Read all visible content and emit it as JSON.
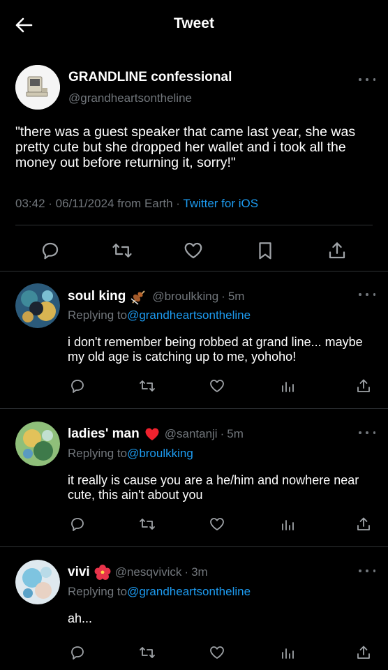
{
  "header": {
    "title": "Tweet"
  },
  "main_tweet": {
    "name": "GRANDLINE confessional",
    "handle": "@grandheartsontheline",
    "text": "\"there was a guest speaker that came last year, she was pretty cute but she dropped her wallet and i took all the money out before returning it, sorry!\"",
    "time": "03:42",
    "date": "06/11/2024",
    "location": "from Earth",
    "source": "Twitter for iOS",
    "icons": [
      "reply-icon",
      "retweet-icon",
      "like-icon",
      "bookmark-icon",
      "share-icon"
    ]
  },
  "replies": [
    {
      "name": "soul king",
      "emoji": "violin",
      "handle": "@broulkking",
      "time": "5m",
      "replying_label": "Replying to",
      "replying_to": "@grandheartsontheline",
      "text": "i don't remember being robbed at grand line... maybe my old age is catching up to me, yohoho!"
    },
    {
      "name": "ladies' man",
      "emoji": "heart",
      "handle": "@santanji",
      "time": "5m",
      "replying_label": "Replying to",
      "replying_to": "@broulkking",
      "text": "it really is cause you are a he/him and nowhere near cute, this ain't about you"
    },
    {
      "name": "vivi",
      "emoji": "hibiscus",
      "handle": "@nesqvivick",
      "time": "3m",
      "replying_label": "Replying to",
      "replying_to": "@grandheartsontheline",
      "text": "ah..."
    }
  ],
  "reply_icons": [
    "reply-icon",
    "retweet-icon",
    "like-icon",
    "analytics-icon",
    "share-icon"
  ],
  "colors": {
    "background": "#000000",
    "text": "#e7e9ea",
    "secondary": "#71767b",
    "link": "#1d9bf0",
    "divider": "#2f3336"
  }
}
